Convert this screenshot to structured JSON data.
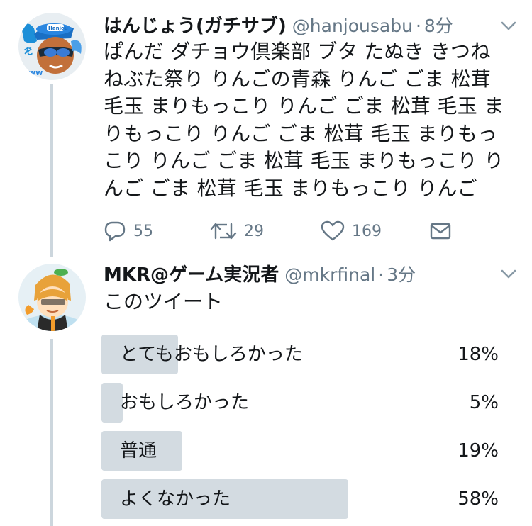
{
  "tweets": [
    {
      "name": "はんじょう(ガチサブ)",
      "handle": "@hanjousabu",
      "separator": "·",
      "time": "8分",
      "text": "ぱんだ ダチョウ倶楽部 ブタ たぬき きつね ねぶた祭り りんごの青森 りんご ごま 松茸 毛玉 まりもっこり りんご ごま 松茸  毛玉 まりもっこり りんご ごま 松茸 毛玉 まりもっこり りんご ごま 松茸 毛玉 まりもっこり りんご ごま 松茸 毛玉 まりもっこり りんご",
      "actions": {
        "replies": "55",
        "retweets": "29",
        "likes": "169"
      },
      "avatar_badge": "Hanjou"
    },
    {
      "name": "MKR@ゲーム実況者",
      "handle": "@mkrfinal",
      "separator": "·",
      "time": "3分",
      "text": "このツイート",
      "poll": [
        {
          "label": "とてもおもしろかった",
          "percent_text": "18%",
          "fraction": 0.18
        },
        {
          "label": "おもしろかった",
          "percent_text": "5%",
          "fraction": 0.05
        },
        {
          "label": "普通",
          "percent_text": "19%",
          "fraction": 0.19
        },
        {
          "label": "よくなかった",
          "percent_text": "58%",
          "fraction": 0.58
        }
      ]
    }
  ],
  "colors": {
    "text": "#14171a",
    "secondary": "#657786",
    "thread_line": "#ccd6dd",
    "poll_fill": "#d3dbe1"
  }
}
